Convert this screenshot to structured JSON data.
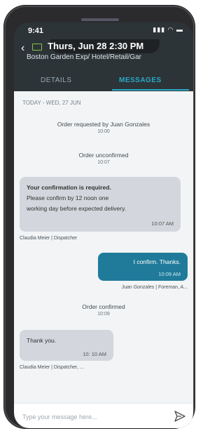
{
  "status": {
    "time": "9:41"
  },
  "header": {
    "title": "Thurs, Jun 28 2:30 PM",
    "subtitle": "Boston Garden Exp/ Hotel/Retail/Gar"
  },
  "tabs": {
    "details": "DETAILS",
    "messages": "MESSAGES"
  },
  "chat": {
    "date_label": "TODAY - WED, 27 JUN",
    "events": [
      {
        "text": "Order requested by Juan Gonzales",
        "time": "10:00"
      },
      {
        "text": "Order unconfirmed",
        "time": "10:07"
      },
      {
        "text": "Order confirmed",
        "time": "10:09"
      }
    ],
    "messages": [
      {
        "line1": "Your confirmation is required.",
        "line2": "Please confirm by 12 noon one",
        "line3": "working day before expected delivery.",
        "time": "10:07 AM",
        "sender": "Claudia Meier | Dispatcher"
      },
      {
        "text": "I confirm. Thanks.",
        "time": "10:09 AM",
        "sender": "Juan Gonzales | Foreman, A..."
      },
      {
        "text": "Thank you.",
        "time": "10: 10 AM",
        "sender": "Claudia Meier | Dispatcher, ..."
      }
    ]
  },
  "composer": {
    "placeholder": "Type your message here..."
  },
  "colors": {
    "accent": "#2aa7c8",
    "outgoing_bubble": "#207b9b",
    "incoming_bubble": "#d3d6dc",
    "header_bg": "#2c3438"
  }
}
